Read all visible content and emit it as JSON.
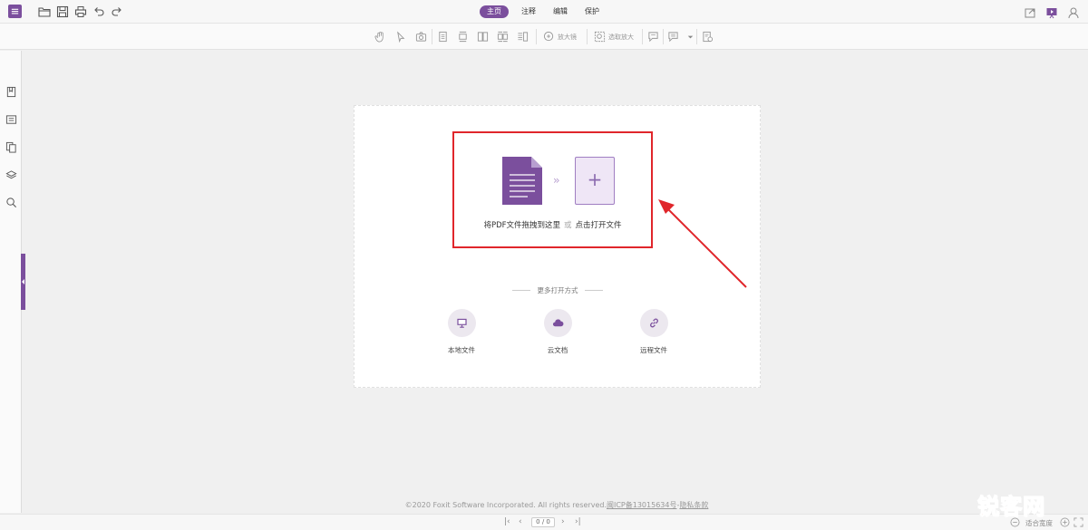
{
  "topbar": {
    "tabs": [
      {
        "label": "主页",
        "active": true
      },
      {
        "label": "注释",
        "active": false
      },
      {
        "label": "编辑",
        "active": false
      },
      {
        "label": "保护",
        "active": false
      }
    ],
    "icons": [
      "menu-icon",
      "open-folder-icon",
      "save-icon",
      "print-icon",
      "undo-icon",
      "redo-icon",
      "share-icon",
      "present-icon",
      "user-icon"
    ]
  },
  "toolbar": {
    "magnifier_label": "放大镜",
    "select_zoom_label": "选取放大",
    "icons": [
      "hand-icon",
      "select-arrow-icon",
      "snapshot-icon",
      "single-page-icon",
      "continuous-page-icon",
      "facing-page-icon",
      "continuous-facing-icon",
      "split-view-icon",
      "magnifier-icon",
      "select-zoom-icon",
      "comment-icon",
      "note-icon",
      "dropdown-icon",
      "document-settings-icon"
    ]
  },
  "sidebar": {
    "icons": [
      "bookmark-icon",
      "comments-panel-icon",
      "pages-icon",
      "layers-icon",
      "search-icon"
    ]
  },
  "main": {
    "drop_text": "将PDF文件拖拽到这里",
    "drop_or": "或",
    "drop_click": "点击打开文件",
    "more_options_title": "更多打开方式",
    "options": [
      {
        "label": "本地文件",
        "icon": "monitor-icon"
      },
      {
        "label": "云文档",
        "icon": "cloud-icon"
      },
      {
        "label": "远程文件",
        "icon": "link-icon"
      }
    ]
  },
  "footer": {
    "copyright_prefix": "©2020 Foxit Software Incorporated. All rights reserved.",
    "icp_link": "闽ICP备13015634号",
    "separator": "-",
    "privacy_link": "隐私条款",
    "page_value": "0 / 0",
    "fit_width_label": "适合宽度"
  },
  "watermark": "锐客网",
  "colors": {
    "accent": "#7b4f9d",
    "highlight": "#e0262b",
    "watermark": "#e8632d"
  }
}
